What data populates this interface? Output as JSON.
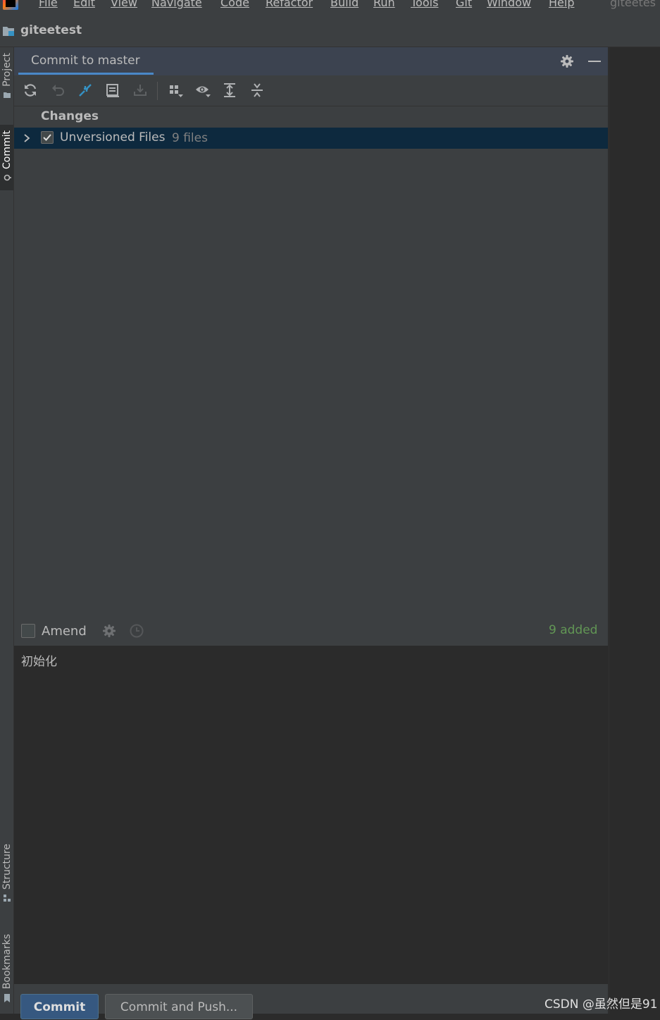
{
  "menu": {
    "items": [
      "File",
      "Edit",
      "View",
      "Navigate",
      "Code",
      "Refactor",
      "Build",
      "Run",
      "Tools",
      "Git",
      "Window",
      "Help"
    ],
    "window_title": "giteetes"
  },
  "project": {
    "name": "giteetest"
  },
  "left_stripe": {
    "project_tab": "Project",
    "commit_tab": "Commit",
    "structure_tab": "Structure",
    "bookmarks_tab": "Bookmarks"
  },
  "tool_window": {
    "tab_label": "Commit to master",
    "toolbar_icons": [
      "refresh-icon",
      "rollback-icon",
      "show-diff-icon",
      "shelf-icon",
      "unshelve-icon",
      "group-by-icon",
      "view-options-icon",
      "expand-all-icon",
      "collapse-all-icon"
    ]
  },
  "changes": {
    "header": "Changes",
    "unversioned_label": "Unversioned Files",
    "unversioned_count": "9 files",
    "unversioned_checked": true
  },
  "options": {
    "amend_label": "Amend",
    "added_count": "9 added"
  },
  "commit_message": "初始化",
  "buttons": {
    "commit": "Commit",
    "commit_and_push": "Commit and Push..."
  },
  "watermark": "CSDN @虽然但是91",
  "colors": {
    "accent": "#4a88c7",
    "selection": "#0d293e",
    "added": "#629755",
    "primary_button": "#365880"
  }
}
